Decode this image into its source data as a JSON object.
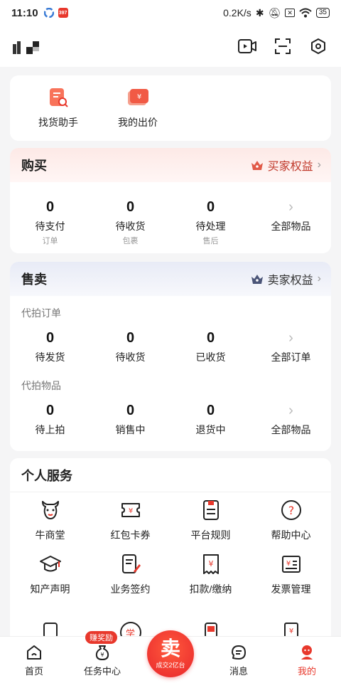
{
  "status_bar": {
    "time": "11:10",
    "network_speed": "0.2K/s",
    "battery": "35",
    "app_badge": "397"
  },
  "header": {
    "icons": [
      "video-icon",
      "scan-icon",
      "settings-icon"
    ]
  },
  "tools": [
    {
      "label": "找货助手",
      "icon": "search-doc-icon"
    },
    {
      "label": "我的出价",
      "icon": "bid-wallet-icon"
    }
  ],
  "buy": {
    "title": "购买",
    "rights_label": "买家权益",
    "items": [
      {
        "value": "0",
        "label": "待支付",
        "sub": "订单"
      },
      {
        "value": "0",
        "label": "待收货",
        "sub": "包裹"
      },
      {
        "value": "0",
        "label": "待处理",
        "sub": "售后"
      },
      {
        "value": "",
        "label": "全部物品",
        "sub": ""
      }
    ]
  },
  "sell": {
    "title": "售卖",
    "rights_label": "卖家权益",
    "orders_heading": "代拍订单",
    "orders": [
      {
        "value": "0",
        "label": "待发货"
      },
      {
        "value": "0",
        "label": "待收货"
      },
      {
        "value": "0",
        "label": "已收货"
      },
      {
        "value": "",
        "label": "全部订单"
      }
    ],
    "goods_heading": "代拍物品",
    "goods": [
      {
        "value": "0",
        "label": "待上拍"
      },
      {
        "value": "0",
        "label": "销售中"
      },
      {
        "value": "0",
        "label": "退货中"
      },
      {
        "value": "",
        "label": "全部物品"
      }
    ]
  },
  "services": {
    "title": "个人服务",
    "items": [
      {
        "label": "牛商堂",
        "icon": "bull-icon"
      },
      {
        "label": "红包卡券",
        "icon": "coupon-icon"
      },
      {
        "label": "平台规则",
        "icon": "rules-icon"
      },
      {
        "label": "帮助中心",
        "icon": "help-icon"
      },
      {
        "label": "知产声明",
        "icon": "graduation-cap-icon"
      },
      {
        "label": "业务签约",
        "icon": "contract-icon"
      },
      {
        "label": "扣款/缴纳",
        "icon": "payment-receipt-icon"
      },
      {
        "label": "发票管理",
        "icon": "invoice-icon"
      }
    ]
  },
  "tabbar": {
    "tabs": [
      {
        "label": "首页",
        "icon": "home-icon"
      },
      {
        "label": "任务中心",
        "icon": "money-bag-icon",
        "badge": "赚奖励"
      },
      {
        "label": "",
        "icon": ""
      },
      {
        "label": "消息",
        "icon": "message-icon"
      },
      {
        "label": "我的",
        "icon": "profile-icon"
      }
    ],
    "sell_button": {
      "big": "卖",
      "small": "成交2亿台"
    },
    "partial_icon_label": "学"
  },
  "colors": {
    "accent": "#e8382c",
    "background": "#f5f5f6"
  }
}
